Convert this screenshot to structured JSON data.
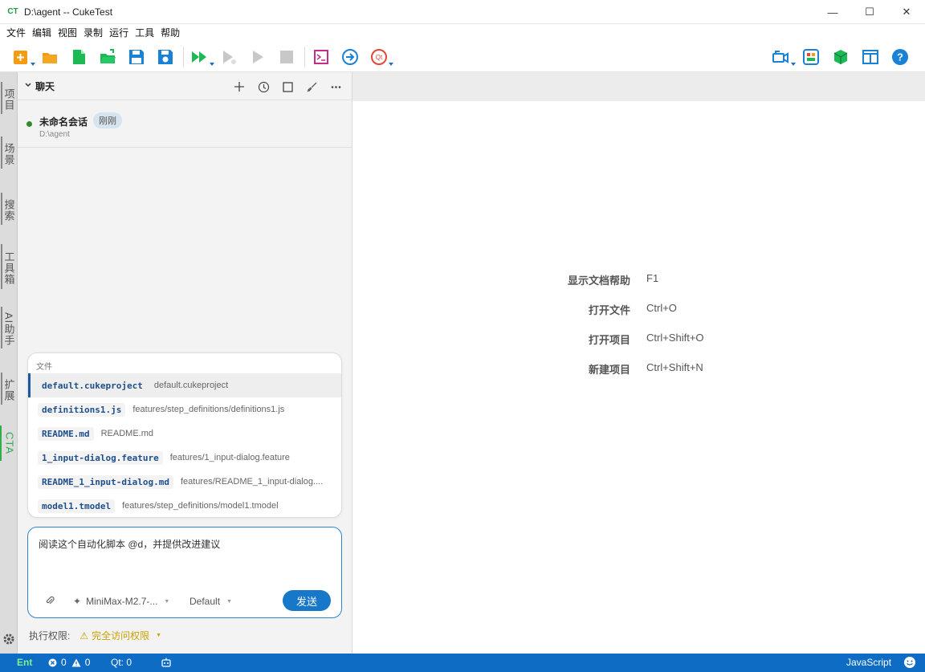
{
  "window": {
    "logo": "CT",
    "title": "D:\\agent -- CukeTest",
    "minimize": "—",
    "maximize": "☐",
    "close": "✕"
  },
  "menu": [
    "文件",
    "编辑",
    "视图",
    "录制",
    "运行",
    "工具",
    "帮助"
  ],
  "toolbar": {
    "left_icons": [
      "new-file-icon",
      "open-folder-icon",
      "new-document-icon",
      "open-project-icon",
      "save-icon",
      "save-all-icon",
      "run-all-icon",
      "run-step-icon",
      "run-icon",
      "stop-icon",
      "terminal-icon",
      "navigate-icon",
      "qt-icon"
    ],
    "right_icons": [
      "record-camera-icon",
      "model-manager-icon",
      "cube-icon",
      "layout-icon",
      "help-icon"
    ],
    "colors": {
      "orange": "#f39c12",
      "green": "#1db954",
      "blue": "#1a82d6",
      "magenta": "#c62d8b",
      "red": "#e2473a"
    }
  },
  "vtabs": [
    "项目",
    "场景",
    "搜索",
    "工具箱",
    "AI助手",
    "扩展",
    "CTA"
  ],
  "chat": {
    "title": "聊天",
    "actions": [
      "+",
      "history-icon",
      "square-icon",
      "brush-icon",
      "more-icon"
    ],
    "session": {
      "name": "未命名会话",
      "badge": "刚刚",
      "path": "D:\\agent"
    },
    "popup_label": "文件",
    "files": [
      {
        "name": "default.cukeproject",
        "path": "default.cukeproject"
      },
      {
        "name": "definitions1.js",
        "path": "features/step_definitions/definitions1.js"
      },
      {
        "name": "README.md",
        "path": "README.md"
      },
      {
        "name": "1_input-dialog.feature",
        "path": "features/1_input-dialog.feature"
      },
      {
        "name": "README_1_input-dialog.md",
        "path": "features/README_1_input-dialog...."
      },
      {
        "name": "model1.tmodel",
        "path": "features/step_definitions/model1.tmodel"
      }
    ],
    "input_text": "阅读这个自动化脚本 @d，并提供改进建议",
    "model": "MiniMax-M2.7-...",
    "mode": "Default",
    "send": "发送",
    "permission_label": "执行权限:",
    "permission_value": "完全访问权限"
  },
  "shortcuts": [
    {
      "label": "显示文档帮助",
      "key": "F1"
    },
    {
      "label": "打开文件",
      "key": "Ctrl+O"
    },
    {
      "label": "打开项目",
      "key": "Ctrl+Shift+O"
    },
    {
      "label": "新建项目",
      "key": "Ctrl+Shift+N"
    }
  ],
  "statusbar": {
    "ent": "Ent",
    "errors": "0",
    "warnings": "0",
    "qt": "Qt: 0",
    "language": "JavaScript"
  }
}
